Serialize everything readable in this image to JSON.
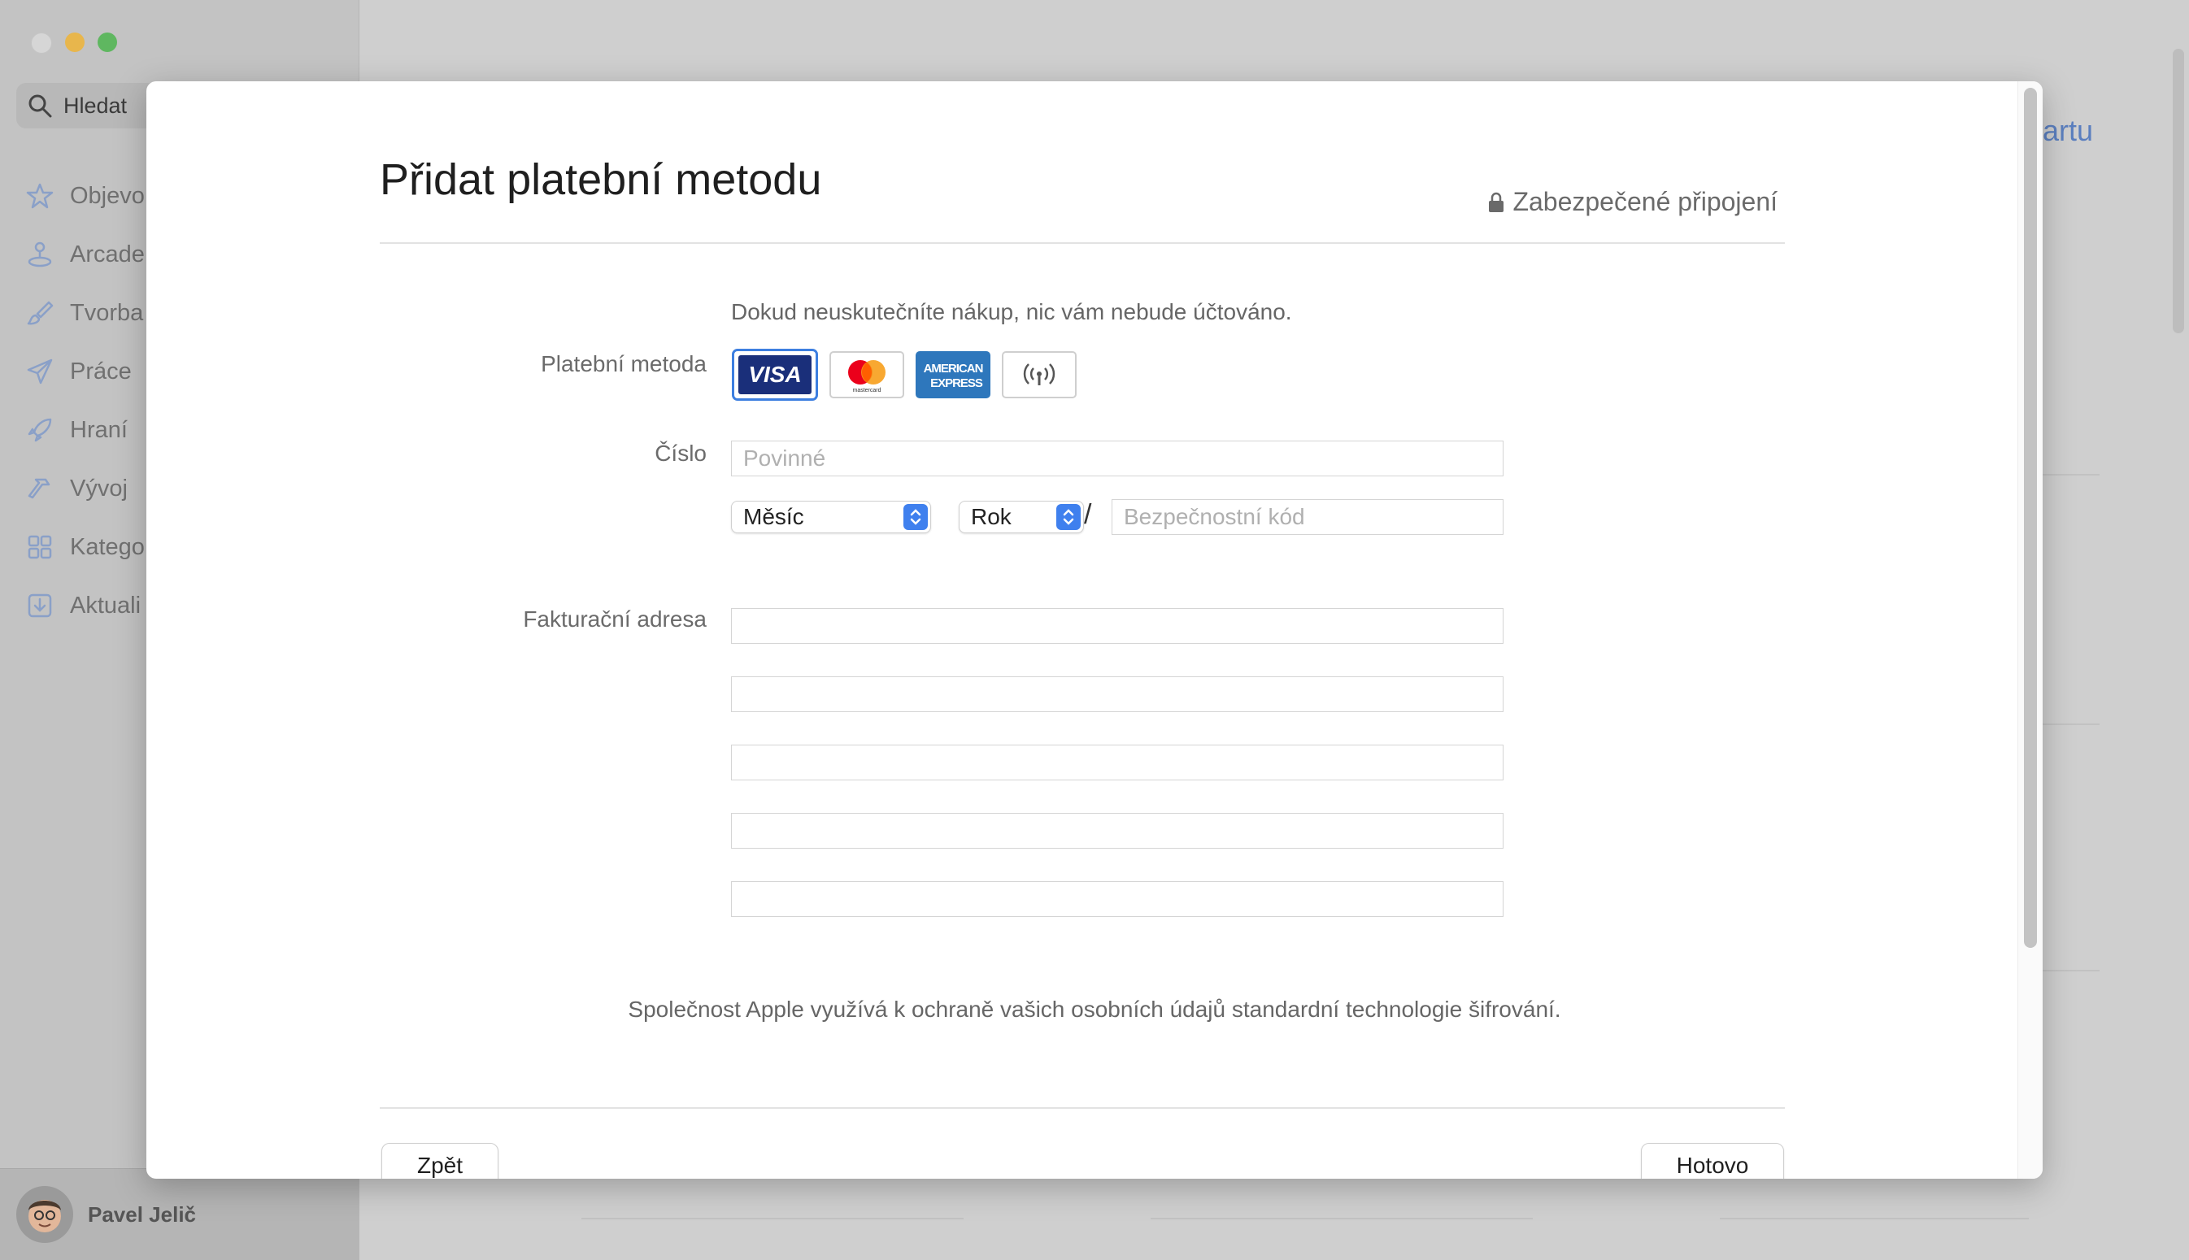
{
  "window": {
    "traffic_lights": [
      "close",
      "minimize",
      "maximize"
    ]
  },
  "sidebar": {
    "search_label": "Hledat",
    "items": [
      {
        "label": "Objevo",
        "icon": "star-icon"
      },
      {
        "label": "Arcade",
        "icon": "joystick-icon"
      },
      {
        "label": "Tvorba",
        "icon": "brush-icon"
      },
      {
        "label": "Práce",
        "icon": "paper-plane-icon"
      },
      {
        "label": "Hraní",
        "icon": "rocket-icon"
      },
      {
        "label": "Vývoj",
        "icon": "hammer-icon"
      },
      {
        "label": "Katego",
        "icon": "grid-icon"
      },
      {
        "label": "Aktuali",
        "icon": "download-icon"
      }
    ],
    "user_name": "Pavel Jelič"
  },
  "background": {
    "link_fragment": "artu"
  },
  "dialog": {
    "title": "Přidat platební metodu",
    "secure_label": "Zabezpečené připojení",
    "info_text": "Dokud neuskutečníte nákup, nic vám nebude účtováno.",
    "payment_method_label": "Platební metoda",
    "cards": [
      {
        "name": "VISA",
        "icon": "visa-icon",
        "selected": true
      },
      {
        "name": "mastercard",
        "icon": "mastercard-icon",
        "selected": false
      },
      {
        "name": "AMERICAN EXPRESS",
        "icon": "amex-icon",
        "selected": false
      },
      {
        "name": "contactless",
        "icon": "contactless-icon",
        "selected": false
      }
    ],
    "number_label": "Číslo",
    "number_placeholder": "Povinné",
    "month_value": "Měsíc",
    "slash": "/",
    "year_value": "Rok",
    "security_code_placeholder": "Bezpečnostní kód",
    "billing_label": "Fakturační adresa",
    "privacy_text": "Společnost Apple využívá k ochraně vašich osobních údajů standardní technologie šifrování.",
    "back_button": "Zpět",
    "done_button": "Hotovo"
  },
  "colors": {
    "accent": "#3f80ee",
    "visa_blue": "#1a2f7a",
    "mastercard_red": "#eb001b",
    "mastercard_orange": "#f79e1b",
    "amex_blue": "#2e77bc"
  }
}
